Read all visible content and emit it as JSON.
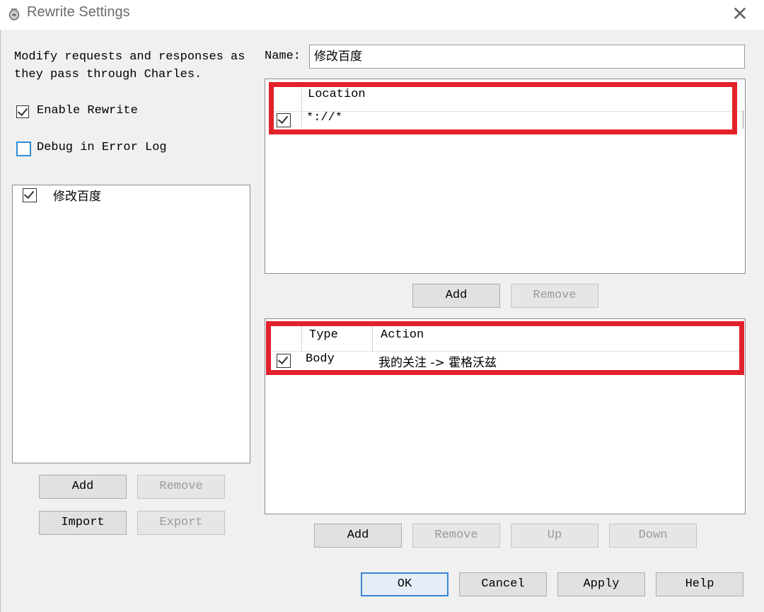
{
  "window": {
    "title": "Rewrite Settings",
    "icon": "charles-vase-icon",
    "close_icon": "close-icon"
  },
  "left": {
    "description": "Modify requests and responses as\nthey pass through Charles.",
    "enable_rewrite": {
      "label": "Enable Rewrite",
      "checked": true
    },
    "debug_error_log": {
      "label": "Debug in Error Log",
      "checked": false
    },
    "rule_sets": [
      {
        "name": "修改百度",
        "checked": true
      }
    ],
    "buttons": {
      "add": "Add",
      "remove": "Remove",
      "import": "Import",
      "export": "Export"
    }
  },
  "right": {
    "name_label": "Name:",
    "name_value": "修改百度",
    "locations": {
      "header": "Location",
      "rows": [
        {
          "checked": true,
          "location": "*://*"
        }
      ],
      "buttons": {
        "add": "Add",
        "remove": "Remove"
      }
    },
    "rules": {
      "headers": {
        "type": "Type",
        "action": "Action"
      },
      "rows": [
        {
          "checked": true,
          "type": "Body",
          "action": "我的关注 -> 霍格沃兹"
        }
      ],
      "buttons": {
        "add": "Add",
        "remove": "Remove",
        "up": "Up",
        "down": "Down"
      }
    }
  },
  "footer": {
    "ok": "OK",
    "cancel": "Cancel",
    "apply": "Apply",
    "help": "Help"
  },
  "colors": {
    "highlight_red": "#e3212a",
    "focus_blue": "#3a86d4",
    "checkbox_blue": "#2e8fd6"
  }
}
